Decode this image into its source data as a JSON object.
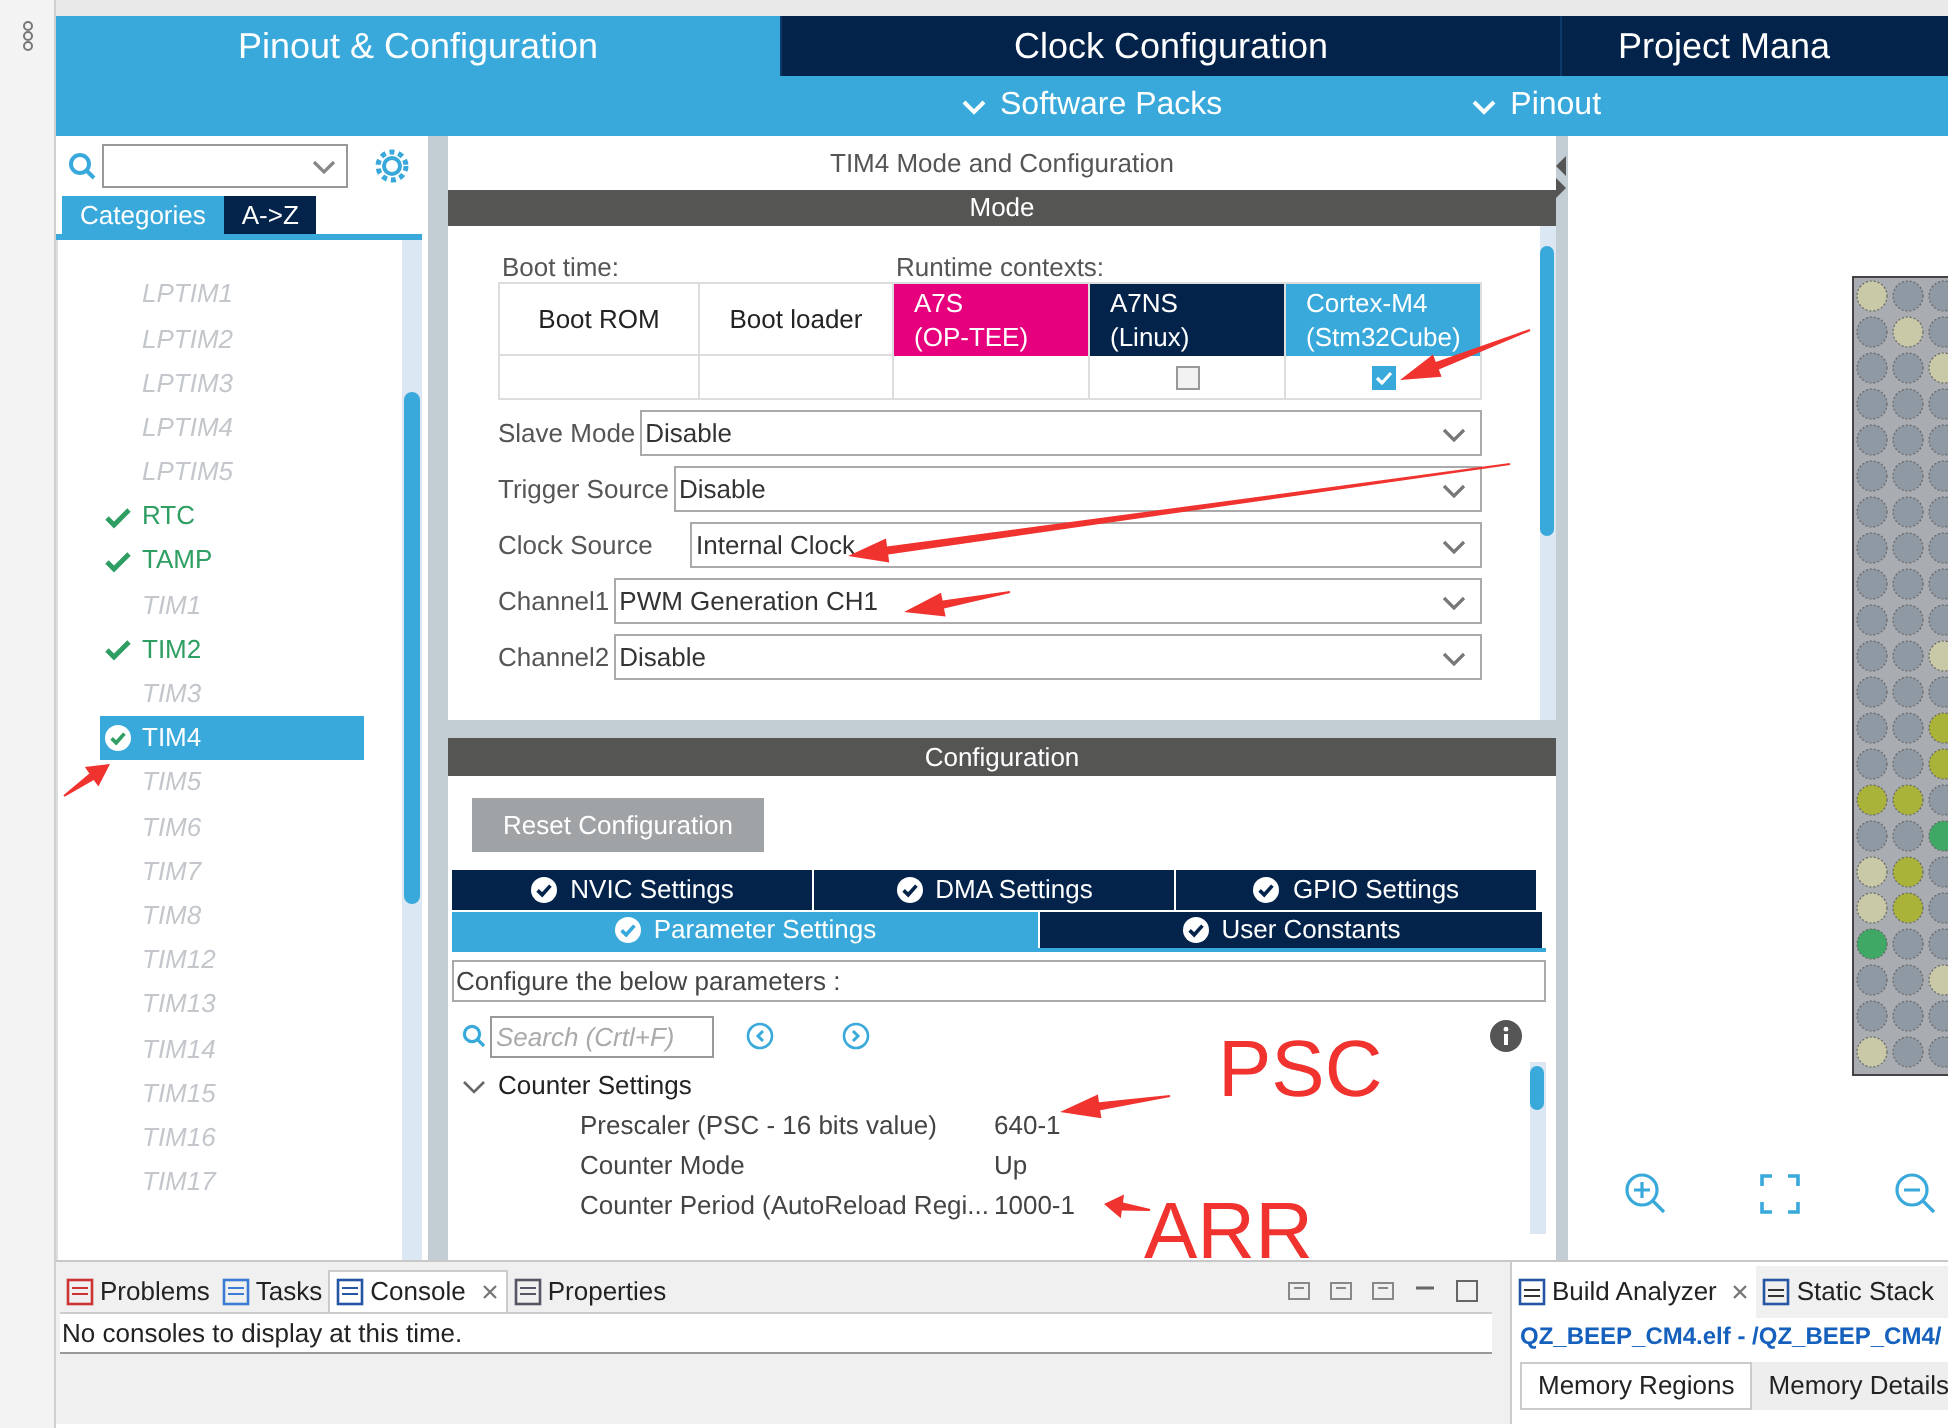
{
  "top_tabs": [
    {
      "label": "Pinout & Configuration",
      "selected": true
    },
    {
      "label": "Clock Configuration",
      "selected": false
    },
    {
      "label": "Project Mana",
      "selected": false
    }
  ],
  "sub_menus": [
    {
      "label": "Software Packs"
    },
    {
      "label": "Pinout"
    }
  ],
  "sidebar": {
    "view_tabs": [
      {
        "label": "Categories",
        "selected": true
      },
      {
        "label": "A->Z",
        "selected": false
      }
    ],
    "items": [
      {
        "label": "LPTIM1",
        "kind": "unavailable",
        "selected": false
      },
      {
        "label": "LPTIM2",
        "kind": "unavailable",
        "selected": false
      },
      {
        "label": "LPTIM3",
        "kind": "unavailable",
        "selected": false
      },
      {
        "label": "LPTIM4",
        "kind": "unavailable",
        "selected": false
      },
      {
        "label": "LPTIM5",
        "kind": "unavailable",
        "selected": false
      },
      {
        "label": "RTC",
        "kind": "configured",
        "selected": false
      },
      {
        "label": "TAMP",
        "kind": "configured",
        "selected": false
      },
      {
        "label": "TIM1",
        "kind": "unavailable",
        "selected": false
      },
      {
        "label": "TIM2",
        "kind": "configured",
        "selected": false
      },
      {
        "label": "TIM3",
        "kind": "unavailable",
        "selected": false
      },
      {
        "label": "TIM4",
        "kind": "configured",
        "selected": true
      },
      {
        "label": "TIM5",
        "kind": "unavailable",
        "selected": false
      },
      {
        "label": "TIM6",
        "kind": "unavailable",
        "selected": false
      },
      {
        "label": "TIM7",
        "kind": "unavailable",
        "selected": false
      },
      {
        "label": "TIM8",
        "kind": "unavailable",
        "selected": false
      },
      {
        "label": "TIM12",
        "kind": "unavailable",
        "selected": false
      },
      {
        "label": "TIM13",
        "kind": "unavailable",
        "selected": false
      },
      {
        "label": "TIM14",
        "kind": "unavailable",
        "selected": false
      },
      {
        "label": "TIM15",
        "kind": "unavailable",
        "selected": false
      },
      {
        "label": "TIM16",
        "kind": "unavailable",
        "selected": false
      },
      {
        "label": "TIM17",
        "kind": "unavailable",
        "selected": false
      }
    ]
  },
  "mode_panel": {
    "title": "TIM4 Mode and Configuration",
    "header": "Mode",
    "boot_label": "Boot time:",
    "runtime_label": "Runtime contexts:",
    "boot_columns": [
      "Boot ROM",
      "Boot loader"
    ],
    "contexts": [
      {
        "name": "A7S",
        "sub": "(OP-TEE)",
        "color": "#e6007e",
        "kind": "label"
      },
      {
        "name": "A7NS",
        "sub": "(Linux)",
        "color": "#03234b",
        "kind": "checkbox",
        "checked": false
      },
      {
        "name": "Cortex-M4",
        "sub": "(Stm32Cube)",
        "color": "#39a9db",
        "kind": "checkbox",
        "checked": true
      }
    ],
    "fields": [
      {
        "label": "Slave Mode",
        "value": "Disable"
      },
      {
        "label": "Trigger Source",
        "value": "Disable"
      },
      {
        "label": "Clock Source",
        "value": "Internal Clock"
      },
      {
        "label": "Channel1",
        "value": "PWM Generation CH1"
      },
      {
        "label": "Channel2",
        "value": "Disable"
      }
    ]
  },
  "config_panel": {
    "header": "Configuration",
    "reset_button": "Reset Configuration",
    "tabs": [
      {
        "label": "NVIC Settings",
        "selected": false
      },
      {
        "label": "DMA Settings",
        "selected": false
      },
      {
        "label": "GPIO Settings",
        "selected": false
      },
      {
        "label": "Parameter Settings",
        "selected": true
      },
      {
        "label": "User Constants",
        "selected": false
      }
    ],
    "description": "Configure the below parameters :",
    "search": {
      "placeholder": "Search (Crtl+F)"
    },
    "group": {
      "label": "Counter Settings",
      "expanded": true,
      "params": [
        {
          "name": "Prescaler (PSC - 16 bits value)",
          "value": "640-1"
        },
        {
          "name": "Counter Mode",
          "value": "Up"
        },
        {
          "name": "Counter Period (AutoReload Regi...",
          "value": "1000-1"
        }
      ]
    }
  },
  "annotations": [
    {
      "label": "PSC"
    },
    {
      "label": "ARR"
    }
  ],
  "console": {
    "tabs": [
      {
        "label": "Problems",
        "selected": false
      },
      {
        "label": "Tasks",
        "selected": false
      },
      {
        "label": "Console",
        "selected": true
      },
      {
        "label": "Properties",
        "selected": false
      }
    ],
    "message": "No consoles to display at this time."
  },
  "build_analyzer": {
    "tabs": [
      {
        "label": "Build Analyzer",
        "selected": true
      },
      {
        "label": "Static Stack",
        "selected": false
      }
    ],
    "path": "QZ_BEEP_CM4.elf - /QZ_BEEP_CM4/",
    "subtabs": [
      {
        "label": "Memory Regions",
        "selected": true
      },
      {
        "label": "Memory Details",
        "selected": false
      }
    ]
  }
}
